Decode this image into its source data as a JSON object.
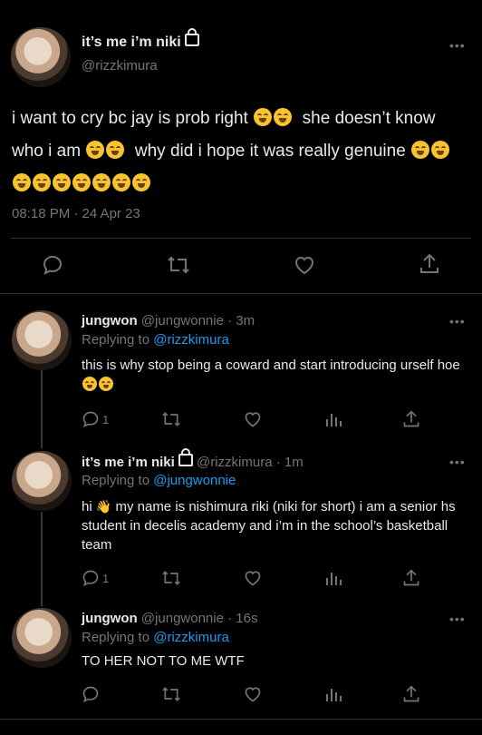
{
  "main_tweet": {
    "display_name": "it’s me i’m niki",
    "handle": "@rizzkimura",
    "text_part1": "i want to cry bc jay is prob right",
    "text_part2": "she doesn’t know who i am",
    "text_part3": "why did i hope it was really genuine",
    "timestamp": "08:18 PM · 24 Apr 23",
    "more": "•••"
  },
  "replies": [
    {
      "display_name": "jungwon",
      "handle": "@jungwonnie",
      "time": "· 3m",
      "replying_prefix": "Replying to",
      "replying_to": "@rizzkimura",
      "text": "this is why stop being a coward and start introducing urself hoe",
      "reply_count": "1",
      "more": "•••"
    },
    {
      "display_name": "it’s me i’m niki",
      "handle": "@rizzkimura",
      "time": "· 1m",
      "replying_prefix": "Replying to",
      "replying_to": "@jungwonnie",
      "text_a": "hi",
      "text_b": "my name is nishimura riki (niki for short) i am a senior hs student in decelis academy and i’m in the school’s basketball team",
      "reply_count": "1",
      "more": "•••"
    },
    {
      "display_name": "jungwon",
      "handle": "@jungwonnie",
      "time": "· 16s",
      "replying_prefix": "Replying to",
      "replying_to": "@rizzkimura",
      "text": "TO HER NOT TO ME WTF",
      "more": "•••"
    }
  ],
  "icons": [
    "reply-icon",
    "retweet-icon",
    "like-icon",
    "share-icon",
    "views-icon",
    "lock-icon",
    "more-icon"
  ],
  "colors": {
    "background": "#000000",
    "text": "#e7e9ea",
    "muted": "#71767b",
    "link": "#1d9bf0",
    "divider": "#2f3336"
  }
}
